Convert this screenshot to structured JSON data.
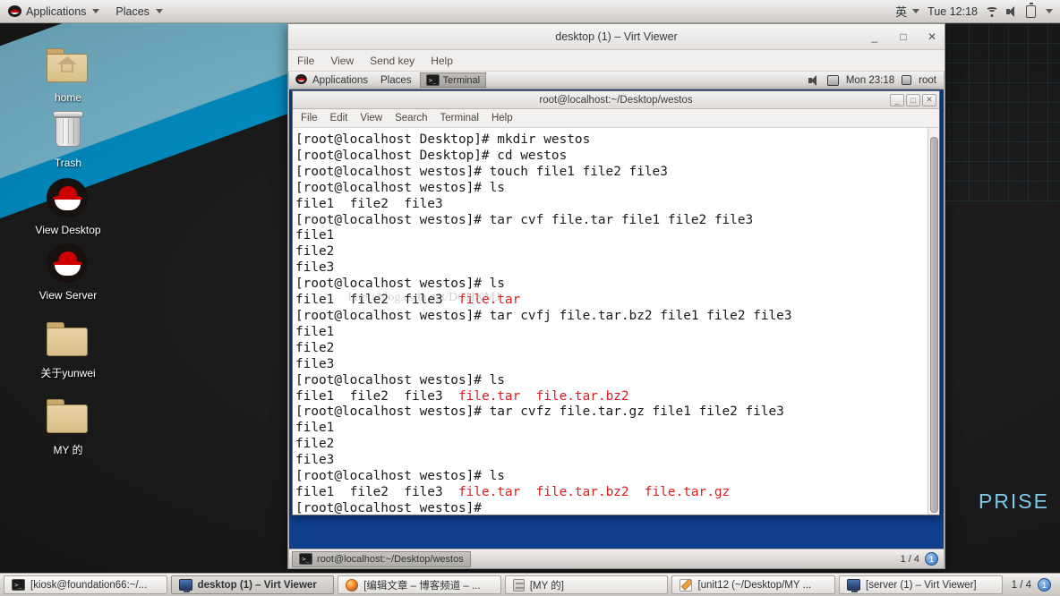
{
  "top_panel": {
    "logo": "redhat-logo-icon",
    "applications": "Applications",
    "places": "Places",
    "ime": "英",
    "clock": "Tue 12:18",
    "icons": [
      "wifi-icon",
      "speaker-muted-icon",
      "battery-icon",
      "chevron-down-icon"
    ]
  },
  "desktop": {
    "wallpaper_text": "PRISE",
    "icons": [
      {
        "label": "home",
        "type": "folder-home"
      },
      {
        "label": "Trash",
        "type": "trash"
      },
      {
        "label": "View Desktop",
        "type": "redhat"
      },
      {
        "label": "View Server",
        "type": "redhat"
      },
      {
        "label": "关于yunwei",
        "type": "folder"
      },
      {
        "label": "MY 的",
        "type": "folder"
      }
    ]
  },
  "virt_viewer": {
    "title": "desktop (1) – Virt Viewer",
    "window_buttons": {
      "minimize": "_",
      "maximize": "□",
      "close": "✕"
    },
    "menus": [
      "File",
      "View",
      "Send key",
      "Help"
    ]
  },
  "guest": {
    "panel": {
      "applications": "Applications",
      "places": "Places",
      "task": "Terminal",
      "clock": "Mon 23:18",
      "user": "root"
    },
    "taskbar": {
      "task": "root@localhost:~/Desktop/westos",
      "workspace": "1 / 4",
      "workspace_badge": "1"
    }
  },
  "terminal": {
    "title": "root@localhost:~/Desktop/westos",
    "window_buttons": {
      "minimize": "_",
      "maximize": "□",
      "close": "✕"
    },
    "menus": [
      "File",
      "Edit",
      "View",
      "Search",
      "Terminal",
      "Help"
    ],
    "watermark": "http://blog.csdn.net/DCHXMJ",
    "lines": [
      [
        {
          "t": "[root@localhost Desktop]# mkdir westos"
        }
      ],
      [
        {
          "t": "[root@localhost Desktop]# cd westos"
        }
      ],
      [
        {
          "t": "[root@localhost westos]# touch file1 file2 file3"
        }
      ],
      [
        {
          "t": "[root@localhost westos]# ls"
        }
      ],
      [
        {
          "t": "file1  file2  file3"
        }
      ],
      [
        {
          "t": "[root@localhost westos]# tar cvf file.tar file1 file2 file3"
        }
      ],
      [
        {
          "t": "file1"
        }
      ],
      [
        {
          "t": "file2"
        }
      ],
      [
        {
          "t": "file3"
        }
      ],
      [
        {
          "t": "[root@localhost westos]# ls"
        }
      ],
      [
        {
          "t": "file1  file2  file3  "
        },
        {
          "t": "file.tar",
          "c": "r"
        }
      ],
      [
        {
          "t": "[root@localhost westos]# tar cvfj file.tar.bz2 file1 file2 file3"
        }
      ],
      [
        {
          "t": "file1"
        }
      ],
      [
        {
          "t": "file2"
        }
      ],
      [
        {
          "t": "file3"
        }
      ],
      [
        {
          "t": "[root@localhost westos]# ls"
        }
      ],
      [
        {
          "t": "file1  file2  file3  "
        },
        {
          "t": "file.tar",
          "c": "r"
        },
        {
          "t": "  "
        },
        {
          "t": "file.tar.bz2",
          "c": "r"
        }
      ],
      [
        {
          "t": "[root@localhost westos]# tar cvfz file.tar.gz file1 file2 file3"
        }
      ],
      [
        {
          "t": "file1"
        }
      ],
      [
        {
          "t": "file2"
        }
      ],
      [
        {
          "t": "file3"
        }
      ],
      [
        {
          "t": "[root@localhost westos]# ls"
        }
      ],
      [
        {
          "t": "file1  file2  file3  "
        },
        {
          "t": "file.tar",
          "c": "r"
        },
        {
          "t": "  "
        },
        {
          "t": "file.tar.bz2",
          "c": "r"
        },
        {
          "t": "  "
        },
        {
          "t": "file.tar.gz",
          "c": "r"
        }
      ],
      [
        {
          "t": "[root@localhost westos]#"
        }
      ]
    ]
  },
  "host_taskbar": {
    "items": [
      {
        "label": "[kiosk@foundation66:~/...",
        "icon": "terminal-icon",
        "active": false
      },
      {
        "label": "desktop (1) – Virt Viewer",
        "icon": "monitor-icon",
        "active": true
      },
      {
        "label": "[编辑文章 – 博客频道 – ...",
        "icon": "firefox-icon",
        "active": false
      },
      {
        "label": "[MY 的]",
        "icon": "files-icon",
        "active": false
      },
      {
        "label": "[unit12 (~/Desktop/MY ...",
        "icon": "editor-icon",
        "active": false
      },
      {
        "label": "[server (1) – Virt Viewer]",
        "icon": "monitor-icon",
        "active": false
      }
    ],
    "workspace": "1 / 4",
    "workspace_badge": "1"
  },
  "colors": {
    "terminal_red": "#e01b1b",
    "guest_desktop_blue": "#0e3e8c",
    "wallpaper_light_blue": "#86cfe8",
    "wallpaper_blue": "#00a0dd"
  }
}
